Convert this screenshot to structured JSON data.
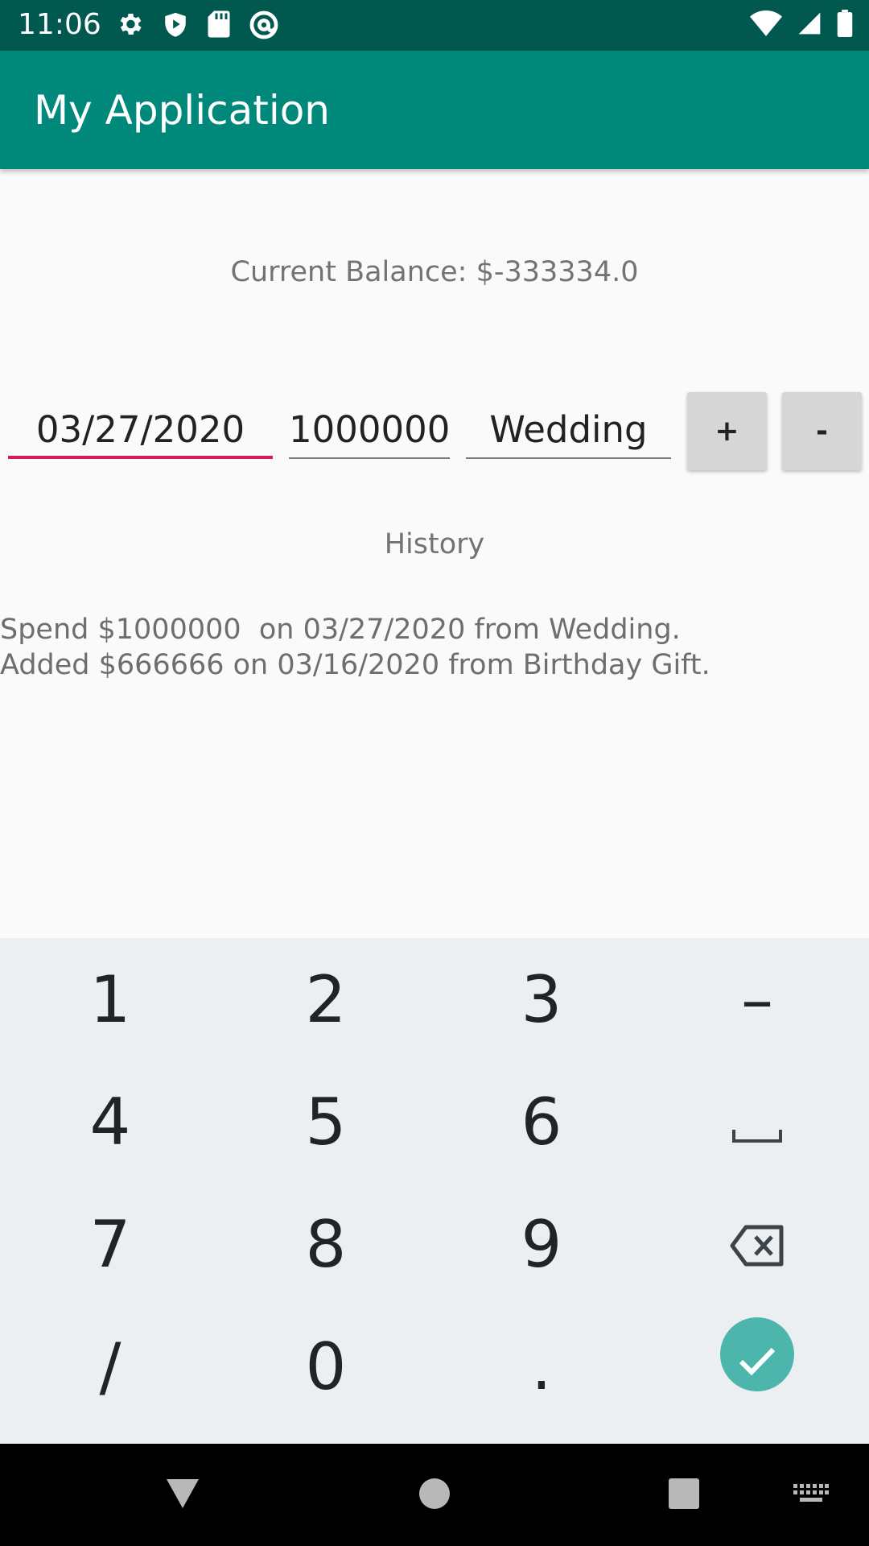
{
  "status_bar": {
    "time": "11:06",
    "left_icons": [
      "settings-icon",
      "shield-icon",
      "sd-card-icon",
      "at-sign-icon"
    ],
    "right_icons": [
      "wifi-icon",
      "cell-signal-icon",
      "battery-icon"
    ]
  },
  "app_bar": {
    "title": "My Application"
  },
  "balance": {
    "text": "Current Balance: $-333334.0"
  },
  "form": {
    "date_value": "03/27/2020",
    "amount_value": "1000000",
    "note_value": "Wedding",
    "add_label": "+",
    "subtract_label": "-"
  },
  "history": {
    "label": "History",
    "items": [
      "Spend $1000000  on 03/27/2020 from Wedding.",
      "Added $666666 on 03/16/2020 from Birthday Gift."
    ]
  },
  "keyboard": {
    "rows": [
      [
        "1",
        "2",
        "3",
        "–"
      ],
      [
        "4",
        "5",
        "6",
        "space-icon"
      ],
      [
        "7",
        "8",
        "9",
        "backspace-icon"
      ],
      [
        "/",
        "0",
        ".",
        "enter-check-icon"
      ]
    ]
  },
  "nav_bar": {
    "icons": [
      "back-triangle-icon",
      "home-circle-icon",
      "recents-square-icon",
      "keyboard-switch-icon"
    ]
  }
}
